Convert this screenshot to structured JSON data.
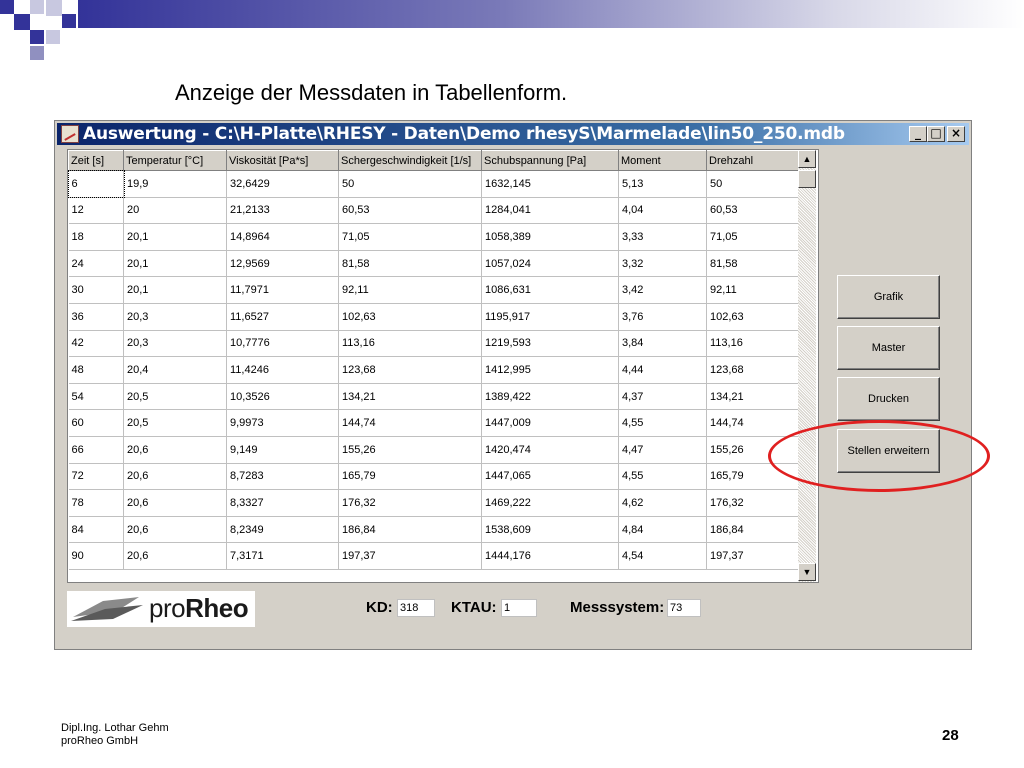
{
  "slide": {
    "title": "Anzeige der Messdaten in Tabellenform.",
    "footer_line1": "Dipl.Ing. Lothar Gehm",
    "footer_line2": "proRheo GmbH",
    "page_number": "28",
    "accent_color": "#333399",
    "highlight_color": "#e02020"
  },
  "window": {
    "title": "Auswertung - C:\\H-Platte\\RHESY - Daten\\Demo rhesyS\\Marmelade\\lin50_250.mdb",
    "minimize_label": "_",
    "maximize_label": "□",
    "close_label": "×",
    "title_color": "#0a246a"
  },
  "table": {
    "columns": [
      "Zeit [s]",
      "Temperatur [°C]",
      "Viskosität [Pa*s]",
      "Schergeschwindigkeit [1/s]",
      "Schubspannung [Pa]",
      "Moment",
      "Drehzahl"
    ],
    "rows": [
      [
        "6",
        "19,9",
        "32,6429",
        "50",
        "1632,145",
        "5,13",
        "50"
      ],
      [
        "12",
        "20",
        "21,2133",
        "60,53",
        "1284,041",
        "4,04",
        "60,53"
      ],
      [
        "18",
        "20,1",
        "14,8964",
        "71,05",
        "1058,389",
        "3,33",
        "71,05"
      ],
      [
        "24",
        "20,1",
        "12,9569",
        "81,58",
        "1057,024",
        "3,32",
        "81,58"
      ],
      [
        "30",
        "20,1",
        "11,7971",
        "92,11",
        "1086,631",
        "3,42",
        "92,11"
      ],
      [
        "36",
        "20,3",
        "11,6527",
        "102,63",
        "1195,917",
        "3,76",
        "102,63"
      ],
      [
        "42",
        "20,3",
        "10,7776",
        "113,16",
        "1219,593",
        "3,84",
        "113,16"
      ],
      [
        "48",
        "20,4",
        "11,4246",
        "123,68",
        "1412,995",
        "4,44",
        "123,68"
      ],
      [
        "54",
        "20,5",
        "10,3526",
        "134,21",
        "1389,422",
        "4,37",
        "134,21"
      ],
      [
        "60",
        "20,5",
        "9,9973",
        "144,74",
        "1447,009",
        "4,55",
        "144,74"
      ],
      [
        "66",
        "20,6",
        "9,149",
        "155,26",
        "1420,474",
        "4,47",
        "155,26"
      ],
      [
        "72",
        "20,6",
        "8,7283",
        "165,79",
        "1447,065",
        "4,55",
        "165,79"
      ],
      [
        "78",
        "20,6",
        "8,3327",
        "176,32",
        "1469,222",
        "4,62",
        "176,32"
      ],
      [
        "84",
        "20,6",
        "8,2349",
        "186,84",
        "1538,609",
        "4,84",
        "186,84"
      ],
      [
        "90",
        "20,6",
        "7,3171",
        "197,37",
        "1444,176",
        "4,54",
        "197,37"
      ]
    ]
  },
  "buttons": {
    "grafik": "Grafik",
    "master": "Master",
    "drucken": "Drucken",
    "stellen": "Stellen erweitern"
  },
  "logo": {
    "text_pro": "pro",
    "text_rheo": "Rheo"
  },
  "fields": {
    "kd_label": "KD:",
    "kd_value": "318",
    "ktau_label": "KTAU:",
    "ktau_value": "1",
    "messsystem_label": "Messsystem:",
    "messsystem_value": "73"
  }
}
